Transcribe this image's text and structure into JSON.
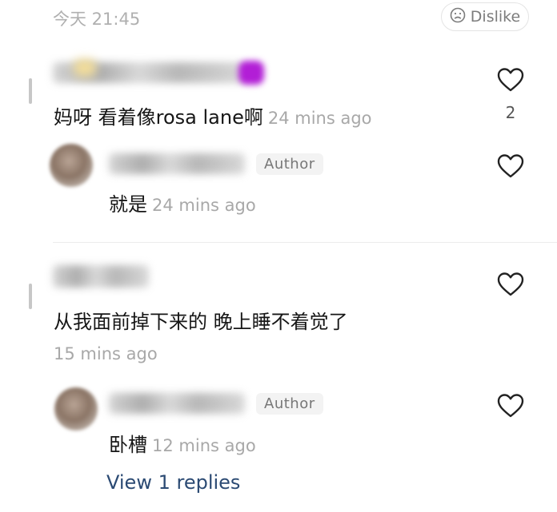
{
  "header": {
    "timestamp": "今天 21:45",
    "dislike_label": "Dislike"
  },
  "comments": [
    {
      "text": "妈呀 看着像rosa lane啊",
      "time": "24 mins ago",
      "like_count": "2",
      "replies": [
        {
          "badge": "Author",
          "text": "就是",
          "time": "24 mins ago"
        }
      ]
    },
    {
      "text": "从我面前掉下来的 晚上睡不着觉了",
      "time": "15 mins ago",
      "replies": [
        {
          "badge": "Author",
          "text": "卧槽",
          "time": "12 mins ago"
        }
      ],
      "view_replies_label": "View 1 replies"
    }
  ],
  "icons": [
    "frown-icon",
    "heart-icon"
  ],
  "colors": {
    "link": "#2b4a73",
    "muted": "#a8a8a8"
  }
}
